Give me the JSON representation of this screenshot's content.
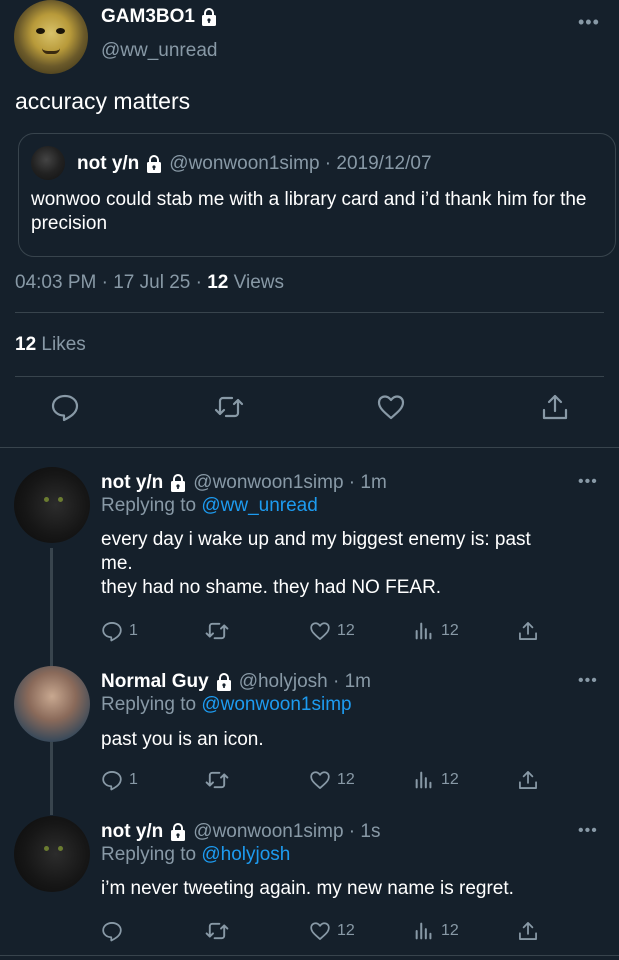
{
  "main_tweet": {
    "display_name": "GAM3BO1",
    "handle": "@ww_unread",
    "more": "•••",
    "text": "accuracy matters",
    "quoted": {
      "display_name": "not y/n",
      "handle_date": "@wonwoon1simp · 2019/12/07",
      "text": "wonwoo could stab me with a library card and i’d thank him for the precision"
    },
    "time_date": "04:03 PM · 17 Jul 25 · ",
    "views_count": "12",
    "views_label": " Views",
    "likes_count": "12",
    "likes_label": " Likes",
    "actions": [
      "reply-icon",
      "retweet-icon",
      "like-icon",
      "share-icon"
    ]
  },
  "replies": [
    {
      "display_name": "not y/n",
      "handle_time": "@wonwoon1simp · 1m",
      "replying_prefix": "Replying to ",
      "replying_to": "@ww_unread",
      "text_lines": [
        "every day i wake up and my biggest enemy is: past",
        "me.",
        "they had no shame. they had NO FEAR."
      ],
      "reply_count": "1",
      "like_count": "12",
      "view_count": "12",
      "more": "•••"
    },
    {
      "display_name": "Normal Guy",
      "handle_time": "@holyjosh · 1m",
      "replying_prefix": "Replying to ",
      "replying_to": "@wonwoon1simp",
      "text_lines": [
        "past you is an icon."
      ],
      "reply_count": "1",
      "like_count": "12",
      "view_count": "12",
      "more": "•••"
    },
    {
      "display_name": "not y/n",
      "handle_time": "@wonwoon1simp · 1s",
      "replying_prefix": "Replying to ",
      "replying_to": "@holyjosh",
      "text_lines": [
        "i’m never tweeting again. my new name is regret."
      ],
      "reply_count": "",
      "like_count": "12",
      "view_count": "12",
      "more": "•••"
    }
  ],
  "colors": {
    "background": "#15202b",
    "muted": "#8899a6",
    "link": "#1d9bf0",
    "border": "#38444d"
  }
}
